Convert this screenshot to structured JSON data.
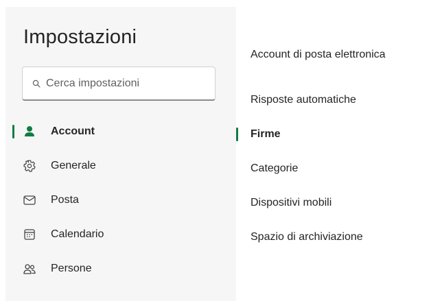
{
  "settings": {
    "title": "Impostazioni",
    "search": {
      "placeholder": "Cerca impostazioni",
      "value": ""
    },
    "nav": [
      {
        "label": "Account",
        "icon": "person-icon",
        "active": true
      },
      {
        "label": "Generale",
        "icon": "gear-icon",
        "active": false
      },
      {
        "label": "Posta",
        "icon": "mail-icon",
        "active": false
      },
      {
        "label": "Calendario",
        "icon": "calendar-icon",
        "active": false
      },
      {
        "label": "Persone",
        "icon": "people-icon",
        "active": false
      }
    ],
    "subnav": [
      {
        "label": "Account di posta elettronica",
        "active": false
      },
      {
        "label": "Risposte automatiche",
        "active": false
      },
      {
        "label": "Firme",
        "active": true
      },
      {
        "label": "Categorie",
        "active": false
      },
      {
        "label": "Dispositivi mobili",
        "active": false
      },
      {
        "label": "Spazio di archiviazione",
        "active": false
      }
    ]
  },
  "colors": {
    "accent": "#107c41",
    "left_pane_bg": "#f6f6f6",
    "text": "#242424"
  }
}
